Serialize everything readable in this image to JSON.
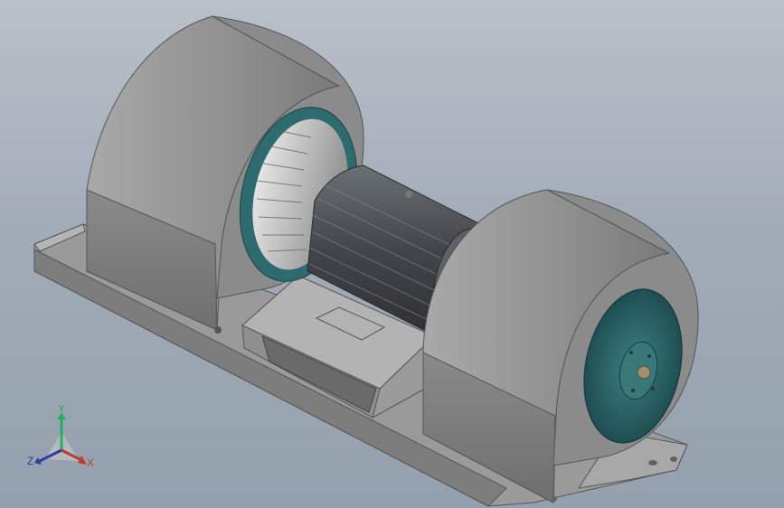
{
  "viewport": {
    "background_top": "#b9c0c9",
    "background_bottom": "#94a0ad"
  },
  "model": {
    "parts": [
      "base-rail",
      "left-blower-housing",
      "motor",
      "right-blower-housing",
      "motor-bracket"
    ],
    "colors": {
      "housing": "#8c8c8c",
      "base": "#9a9a9a",
      "motor": "#4e5256",
      "impeller_ring": "#2e6b6e"
    }
  },
  "triad": {
    "x_label": "X",
    "y_label": "Y",
    "z_label": "Z",
    "x_color": "#c0392b",
    "y_color": "#27ae60",
    "z_color": "#2c3e9e"
  }
}
